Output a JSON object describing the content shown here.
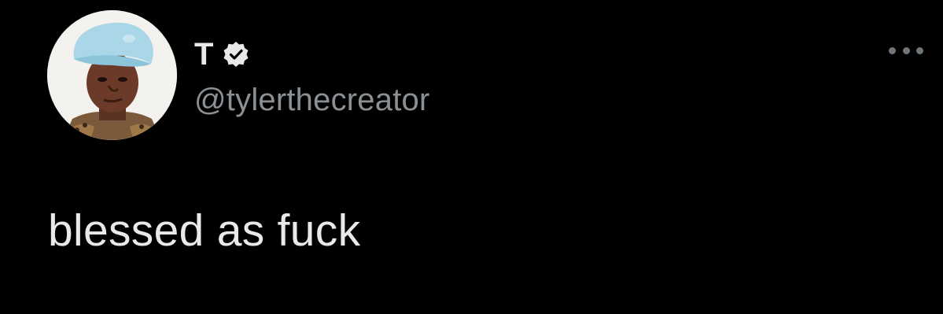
{
  "tweet": {
    "author": {
      "display_name": "T",
      "handle": "@tylerthecreator",
      "verified": true,
      "avatar_icon": "profile-photo"
    },
    "menu_icon": "more-options-icon",
    "text": "blessed as fuck"
  },
  "colors": {
    "background": "#000000",
    "primary_text": "#e7e9ea",
    "secondary_text": "#8b9095",
    "verified_badge": "#e7e9ea"
  }
}
